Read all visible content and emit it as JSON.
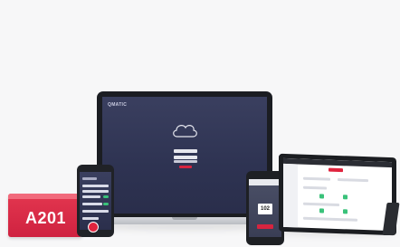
{
  "badge": {
    "label": "A201"
  },
  "laptop": {
    "brand": "QMATIC"
  },
  "phone": {
    "number": "102"
  },
  "colors": {
    "accent": "#d6243f",
    "screen": "#3a3f5f",
    "device": "#1b1d22",
    "toggle": "#3ac27a"
  }
}
